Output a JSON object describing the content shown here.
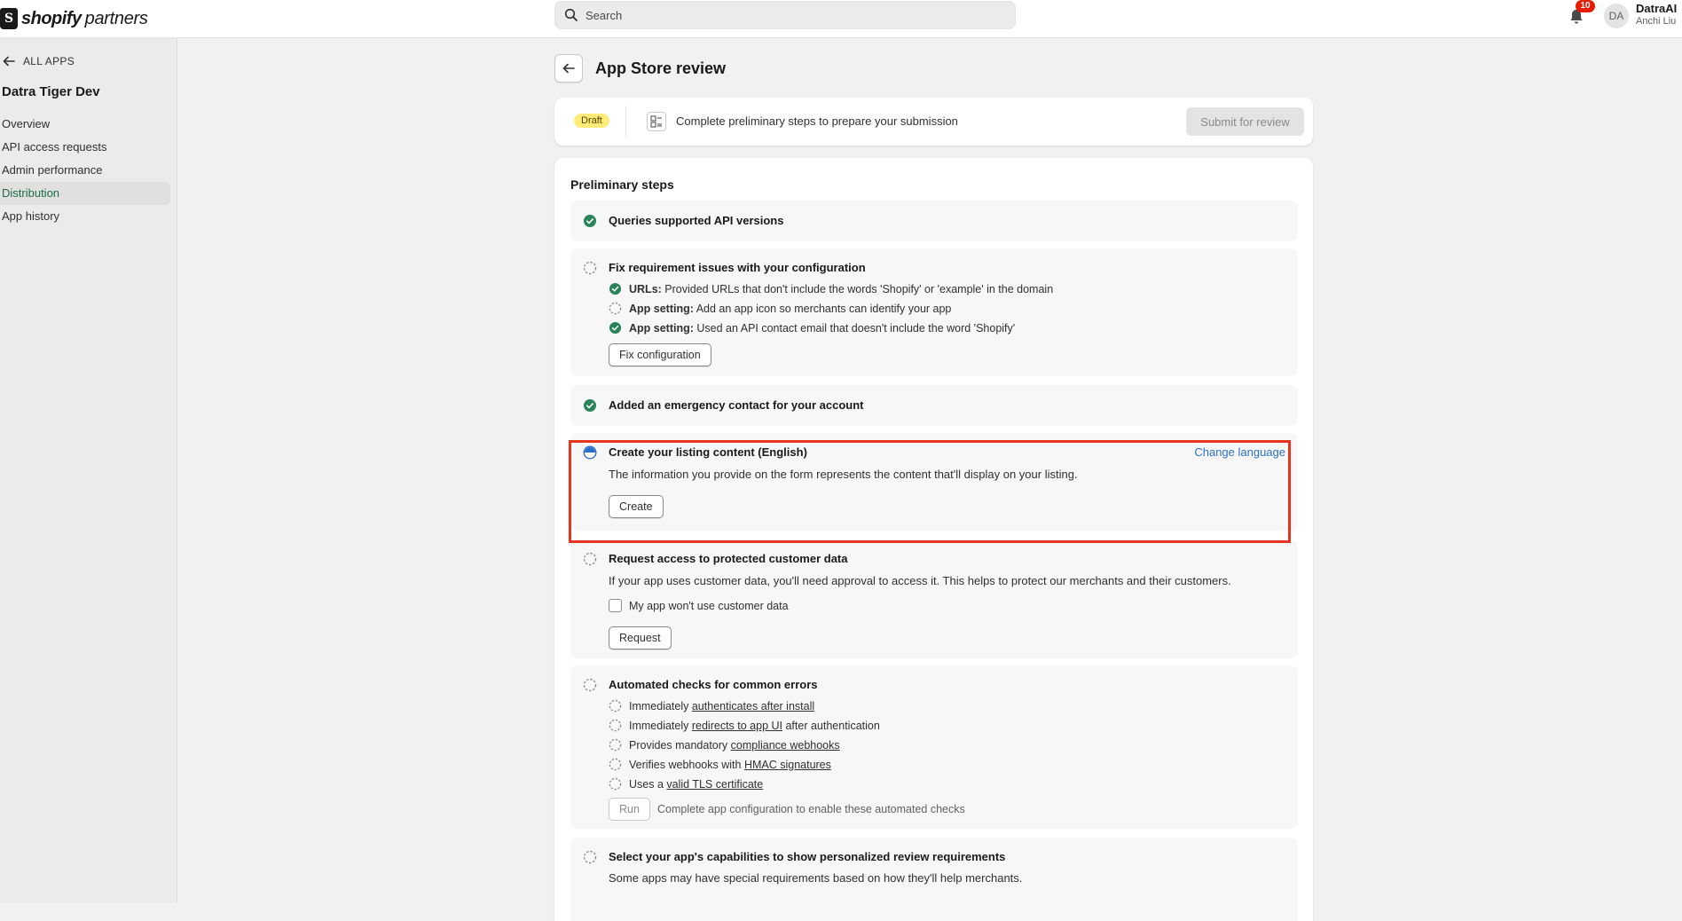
{
  "topbar": {
    "logo_bold": "shopify",
    "logo_light": "partners",
    "search_placeholder": "Search",
    "notifications_count": "10",
    "avatar_initials": "DA",
    "user_name": "DatraAI",
    "user_subtitle": "Anchi Liu"
  },
  "sidebar": {
    "back_label": "ALL APPS",
    "app_name": "Datra Tiger Dev",
    "items": [
      {
        "label": "Overview"
      },
      {
        "label": "API access requests"
      },
      {
        "label": "Admin performance"
      },
      {
        "label": "Distribution"
      },
      {
        "label": "App history"
      }
    ]
  },
  "header": {
    "title": "App Store review"
  },
  "status": {
    "badge": "Draft",
    "message": "Complete preliminary steps to prepare your submission",
    "submit_label": "Submit for review"
  },
  "steps": {
    "title": "Preliminary steps",
    "api_versions": {
      "title": "Queries supported API versions"
    },
    "config": {
      "title": "Fix requirement issues with your configuration",
      "items": [
        {
          "label": "URLs:",
          "text": " Provided URLs that don't include the words 'Shopify' or 'example' in the domain"
        },
        {
          "label": "App setting:",
          "text": " Add an app icon so merchants can identify your app"
        },
        {
          "label": "App setting:",
          "text": " Used an API contact email that doesn't include the word 'Shopify'"
        }
      ],
      "button": "Fix configuration"
    },
    "emergency": {
      "title": "Added an emergency contact for your account"
    },
    "listing": {
      "title": "Create your listing content (English)",
      "link": "Change language",
      "desc": "The information you provide on the form represents the content that'll display on your listing.",
      "button": "Create"
    },
    "customer_data": {
      "title": "Request access to protected customer data",
      "desc": "If your app uses customer data, you'll need approval to access it. This helps to protect our merchants and their customers.",
      "checkbox": "My app won't use customer data",
      "button": "Request"
    },
    "checks": {
      "title": "Automated checks for common errors",
      "items": [
        {
          "pre": "Immediately ",
          "link": "authenticates after install",
          "post": ""
        },
        {
          "pre": "Immediately ",
          "link": "redirects to app UI",
          "post": " after authentication"
        },
        {
          "pre": "Provides mandatory ",
          "link": "compliance webhooks",
          "post": ""
        },
        {
          "pre": "Verifies webhooks with ",
          "link": "HMAC signatures",
          "post": ""
        },
        {
          "pre": "Uses a ",
          "link": "valid TLS certificate",
          "post": ""
        }
      ],
      "button": "Run",
      "note": "Complete app configuration to enable these automated checks"
    },
    "capabilities": {
      "title": "Select your app's capabilities to show personalized review requirements",
      "desc": "Some apps may have special requirements based on how they'll help merchants."
    }
  },
  "colors": {
    "accent_green": "#29845a",
    "link_blue": "#2c6ecb",
    "highlight_red": "#e8341c",
    "draft_yellow": "#ffeb78"
  }
}
